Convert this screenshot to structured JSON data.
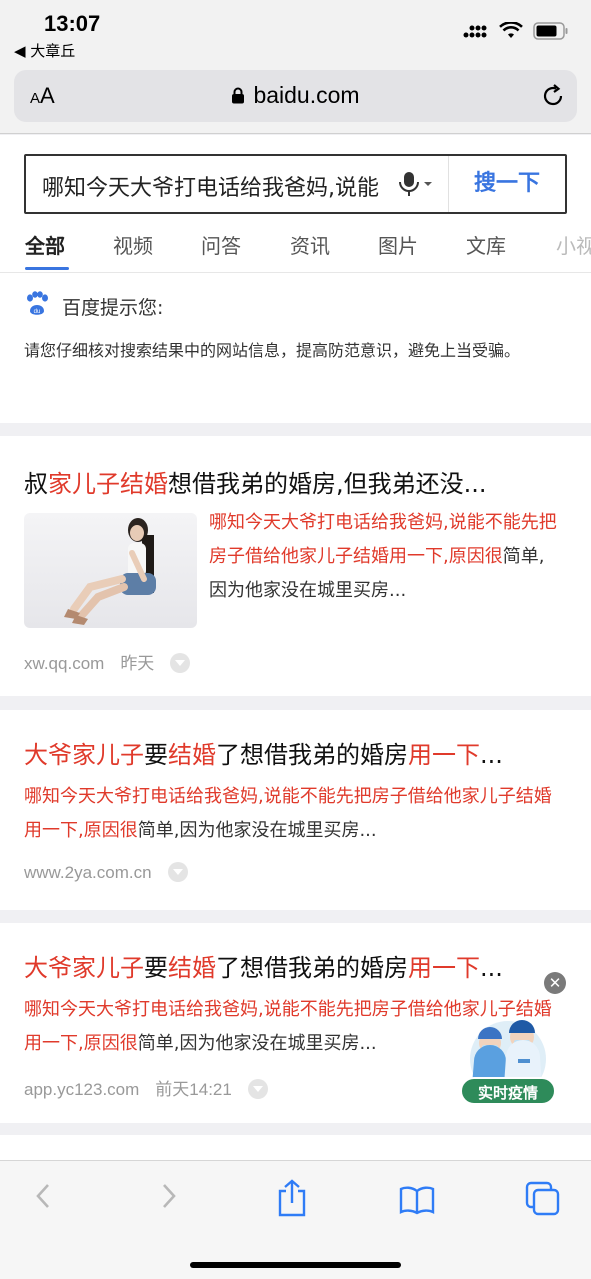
{
  "status": {
    "time": "13:07",
    "back_app": "◀ 大章丘"
  },
  "address": {
    "aa": "AA",
    "domain": "baidu.com"
  },
  "search": {
    "query": "哪知今天大爷打电话给我爸妈,说能",
    "button": "搜一下"
  },
  "tabs": [
    "全部",
    "视频",
    "问答",
    "资讯",
    "图片",
    "文库",
    "小视"
  ],
  "tip": {
    "title": "百度提示您:",
    "body": "请您仔细核对搜索结果中的网站信息，提高防范意识，避免上当受骗。"
  },
  "results": [
    {
      "title": [
        {
          "t": "叔",
          "h": false
        },
        {
          "t": "家儿子结婚",
          "h": true
        },
        {
          "t": "想借我弟的婚房,但我弟还没...",
          "h": false
        }
      ],
      "body": [
        {
          "t": "哪知今天大爷打电话给我爸妈,说能不能先把房子借给他家儿子结婚用一下,原因很",
          "h": true
        },
        {
          "t": "简单,因为他家没在城里买房...",
          "h": false
        }
      ],
      "site": "xw.qq.com",
      "date": "昨天"
    },
    {
      "title": [
        {
          "t": "大爷家儿子",
          "h": true
        },
        {
          "t": "要",
          "h": false
        },
        {
          "t": "结婚",
          "h": true
        },
        {
          "t": "了想借我弟的婚房",
          "h": false
        },
        {
          "t": "用一下",
          "h": true
        },
        {
          "t": "...",
          "h": false
        }
      ],
      "body": [
        {
          "t": "哪知今天大爷打电话给我爸妈,说能不能先把房子借给他家儿子结婚用一下,原因很",
          "h": true
        },
        {
          "t": "简单,因为他家没在城里买房...",
          "h": false
        }
      ],
      "site": "www.2ya.com.cn",
      "date": ""
    },
    {
      "title": [
        {
          "t": "大爷家儿子",
          "h": true
        },
        {
          "t": "要",
          "h": false
        },
        {
          "t": "结婚",
          "h": true
        },
        {
          "t": "了想借我弟的婚房",
          "h": false
        },
        {
          "t": "用一下",
          "h": true
        },
        {
          "t": "...",
          "h": false
        }
      ],
      "body": [
        {
          "t": "哪知今天大爷打电话给我爸妈,说能不能先把房子借给他家儿子结婚用一下,原因很",
          "h": true
        },
        {
          "t": "简单,因为他家没在城里买房...",
          "h": false
        }
      ],
      "site": "app.yc123.com",
      "date": "前天14:21"
    }
  ],
  "floating": {
    "close": "✕",
    "label": "实时疫情"
  },
  "colors": {
    "accent": "#3975e0",
    "highlight": "#e03a2b",
    "badge": "#2e8b5a"
  },
  "toolbar_icons": [
    "back-icon",
    "forward-icon",
    "share-icon",
    "bookmarks-icon",
    "tabs-icon"
  ]
}
